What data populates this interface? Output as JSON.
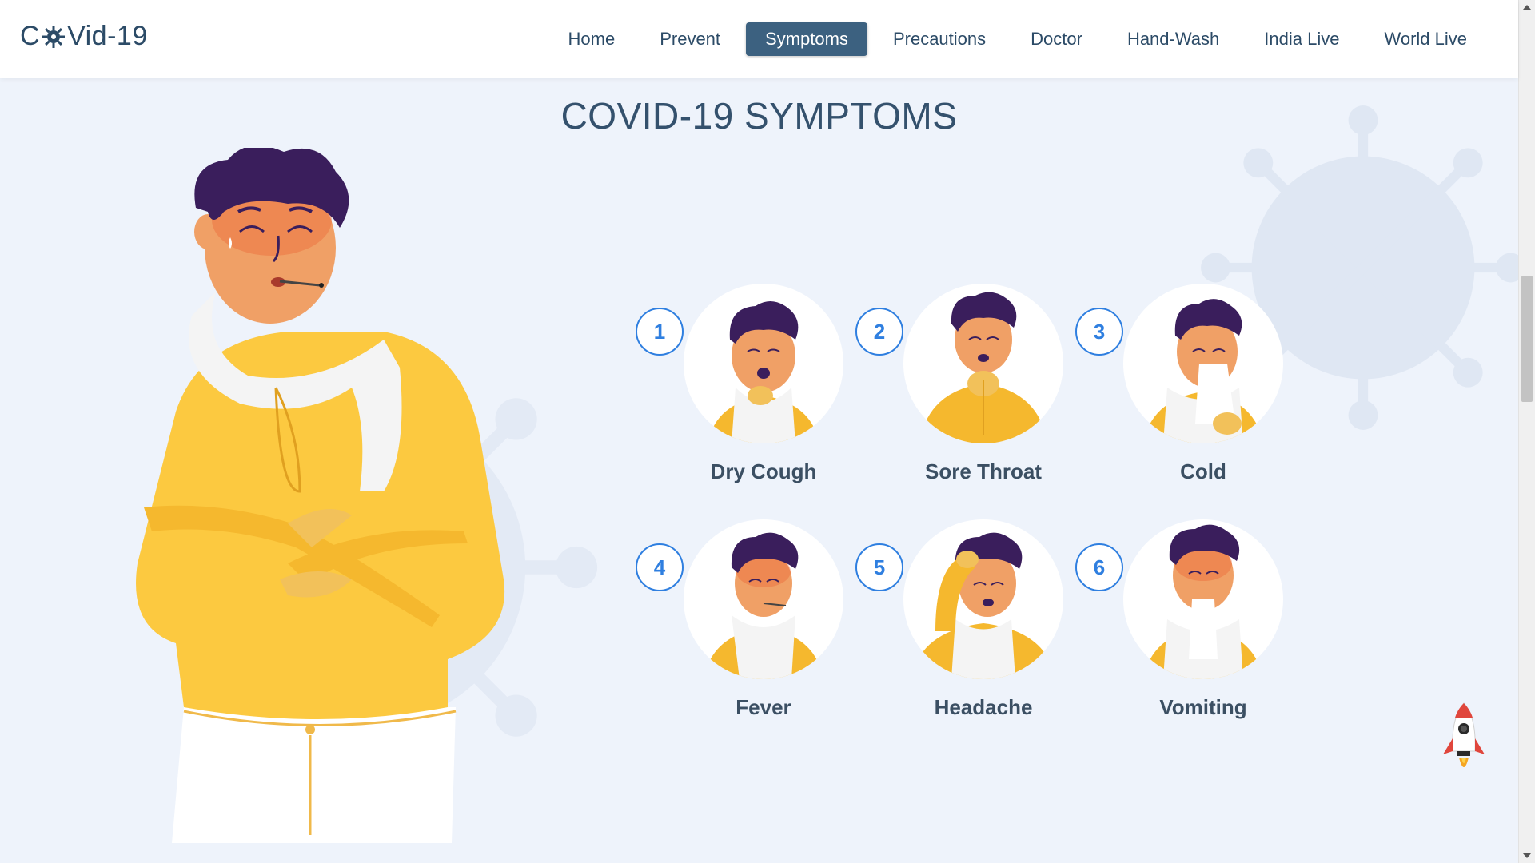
{
  "logo": {
    "prefix": "C",
    "suffix": "Vid-19",
    "icon": "virus-cog-icon"
  },
  "nav": {
    "items": [
      {
        "label": "Home"
      },
      {
        "label": "Prevent"
      },
      {
        "label": "Symptoms",
        "active": true
      },
      {
        "label": "Precautions"
      },
      {
        "label": "Doctor"
      },
      {
        "label": "Hand-Wash"
      },
      {
        "label": "India Live"
      },
      {
        "label": "World Live"
      }
    ]
  },
  "section": {
    "title": "COVID-19 SYMPTOMS"
  },
  "symptoms": [
    {
      "number": "1",
      "label": "Dry Cough"
    },
    {
      "number": "2",
      "label": "Sore Throat"
    },
    {
      "number": "3",
      "label": "Cold"
    },
    {
      "number": "4",
      "label": "Fever"
    },
    {
      "number": "5",
      "label": "Headache"
    },
    {
      "number": "6",
      "label": "Vomiting"
    }
  ],
  "colors": {
    "accent": "#3c6180",
    "badge": "#2f7fe0",
    "background": "#eef3fb",
    "sweater": "#fcc940",
    "hair": "#3a1e5c",
    "skin": "#f0a066"
  },
  "icons": {
    "scroll_top": "rocket-icon"
  }
}
